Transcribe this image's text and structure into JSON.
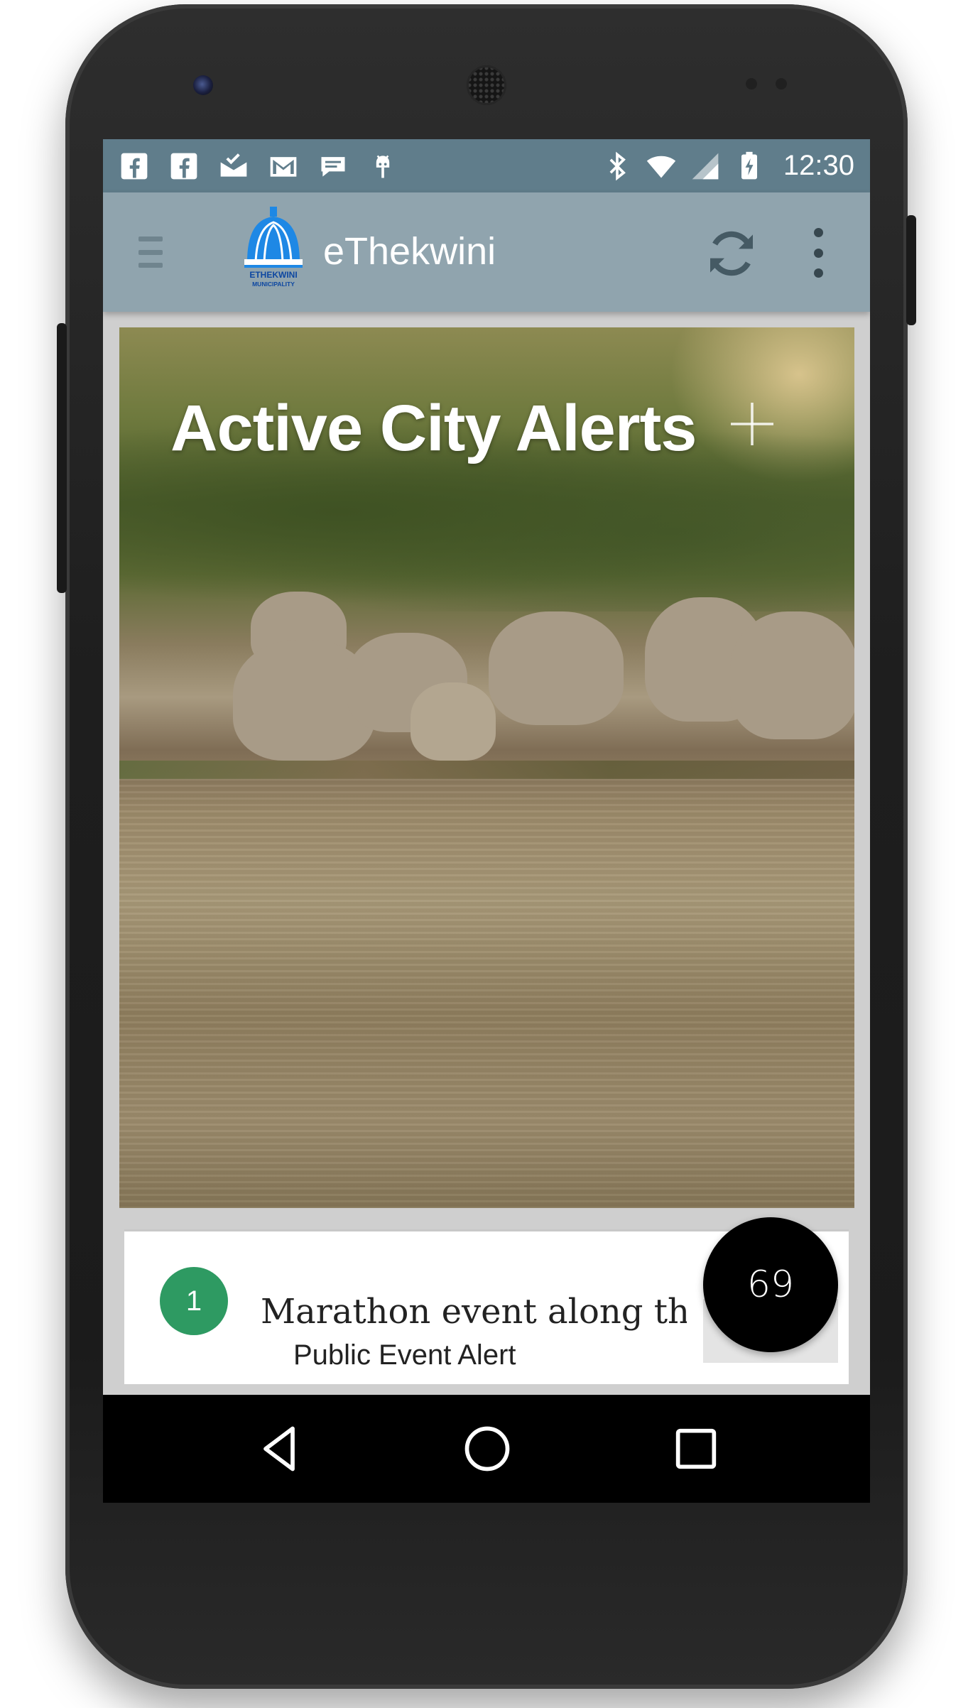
{
  "status_bar": {
    "left_icons": [
      "facebook-icon",
      "facebook-icon",
      "inbox-check-icon",
      "gmail-icon",
      "chat-bubble-icon",
      "android-icon"
    ],
    "right_icons": [
      "bluetooth-icon",
      "wifi-icon",
      "cell-signal-icon",
      "battery-charging-icon"
    ],
    "time": "12:30"
  },
  "app_bar": {
    "logo": "ethekwini-municipality-logo",
    "logo_text": "ETHEKWINI MUNICIPALITY",
    "title": "eThekwini",
    "actions": [
      "refresh-icon",
      "more-vert-icon"
    ]
  },
  "hero": {
    "title": "Active City Alerts",
    "action_icon": "add-icon",
    "image": "elephants drinking at water"
  },
  "alerts": [
    {
      "number": "1",
      "title": "Marathon event along the stre",
      "type": "Public Event Alert"
    }
  ],
  "count_badge": "69",
  "colors": {
    "status_bar": "#607d8b",
    "app_bar": "#90a4ae",
    "alert_number_bg": "#2e9a62",
    "count_badge_bg": "#000000"
  }
}
